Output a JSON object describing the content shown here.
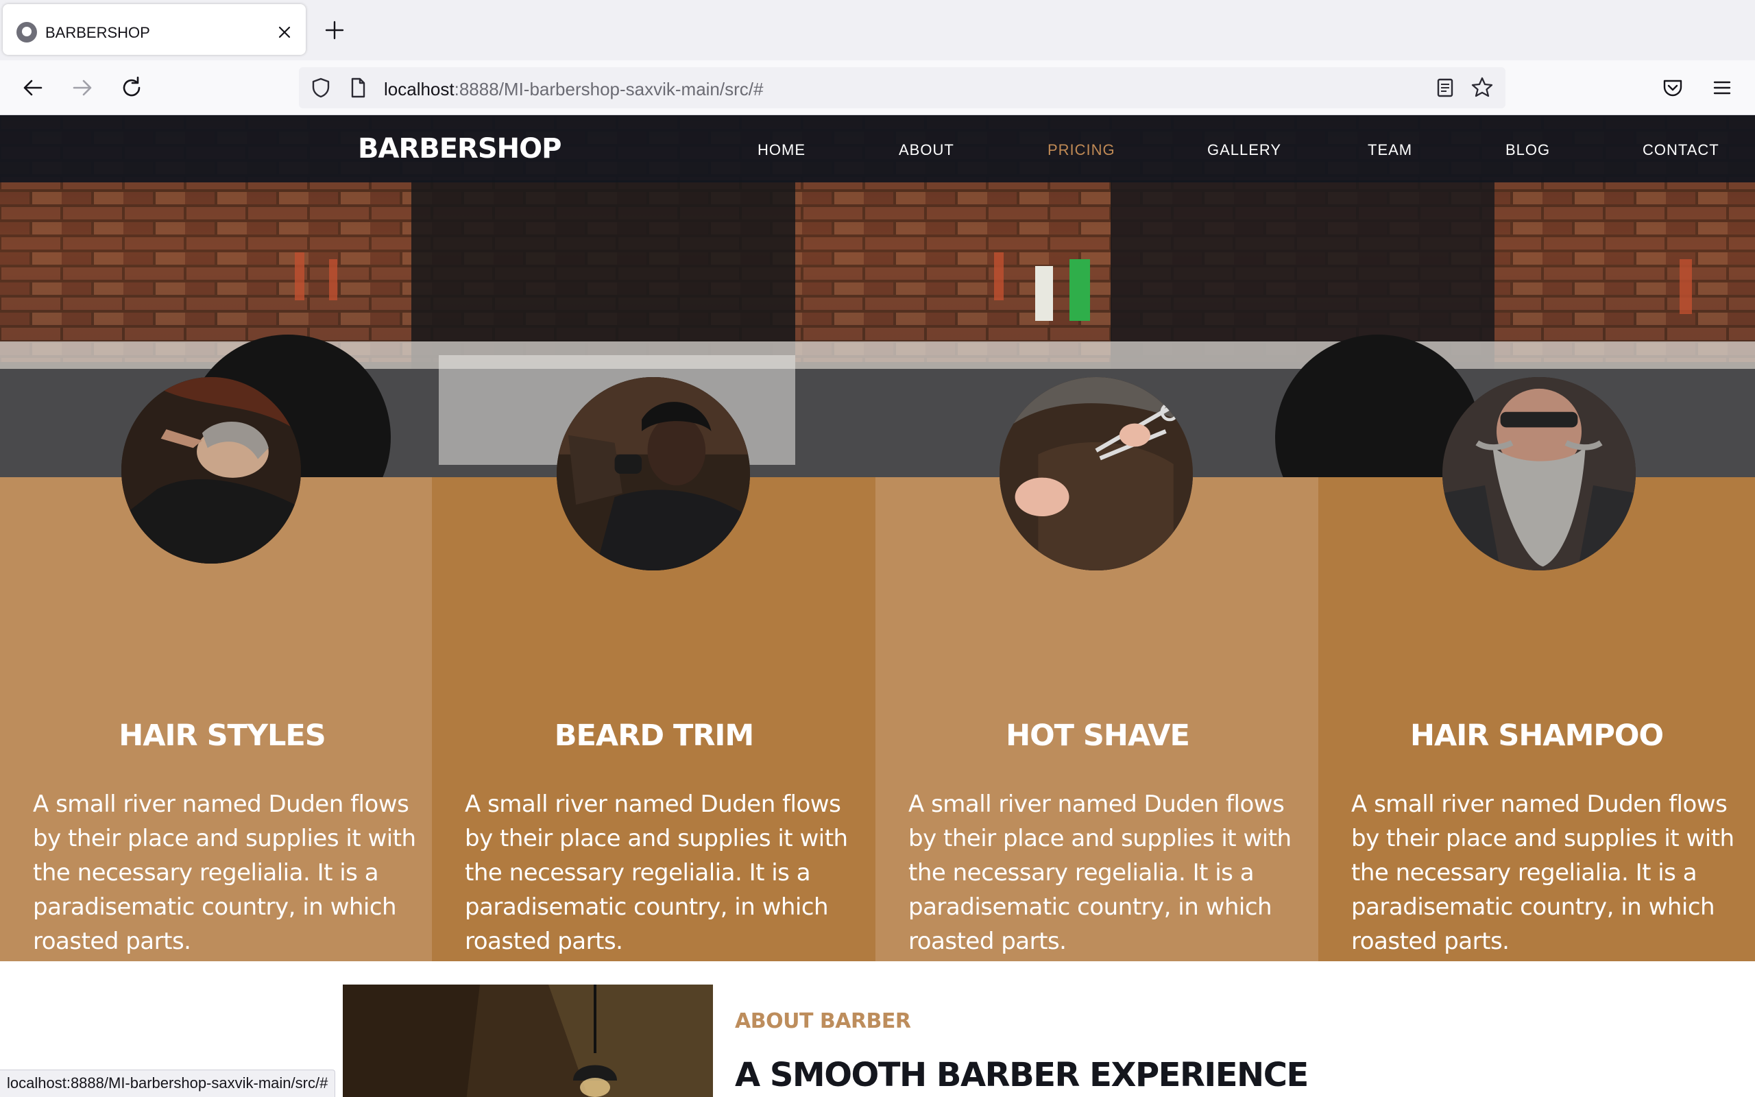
{
  "browser": {
    "tab_title": "BARBERSHOP",
    "url_host": "localhost",
    "url_rest": ":8888/MI-barbershop-saxvik-main/src/#",
    "status_url": "localhost:8888/MI-barbershop-saxvik-main/src/#",
    "icons": [
      "favicon-icon",
      "close-icon",
      "new-tab-icon",
      "back-icon",
      "forward-icon",
      "reload-icon",
      "shield-icon",
      "page-icon",
      "reader-view-icon",
      "bookmark-star-icon",
      "pocket-icon",
      "menu-icon"
    ]
  },
  "site": {
    "brand": "BARBERSHOP",
    "menu": [
      {
        "label": "HOME"
      },
      {
        "label": "ABOUT"
      },
      {
        "label": "PRICING",
        "active": true
      },
      {
        "label": "GALLERY"
      },
      {
        "label": "TEAM"
      },
      {
        "label": "BLOG"
      },
      {
        "label": "CONTACT"
      }
    ],
    "accent_color": "#bd8d5c",
    "services": [
      {
        "title": "HAIR STYLES",
        "text": "A small river named Duden flows by their place and supplies it with the necessary regelialia. It is a paradisematic country, in which roasted parts."
      },
      {
        "title": "BEARD TRIM",
        "text": "A small river named Duden flows by their place and supplies it with the necessary regelialia. It is a paradisematic country, in which roasted parts."
      },
      {
        "title": "HOT SHAVE",
        "text": "A small river named Duden flows by their place and supplies it with the necessary regelialia. It is a paradisematic country, in which roasted parts."
      },
      {
        "title": "HAIR SHAMPOO",
        "text": "A small river named Duden flows by their place and supplies it with the necessary regelialia. It is a paradisematic country, in which roasted parts."
      }
    ],
    "about": {
      "kicker": "ABOUT BARBER",
      "heading": "A SMOOTH BARBER EXPERIENCE"
    }
  }
}
